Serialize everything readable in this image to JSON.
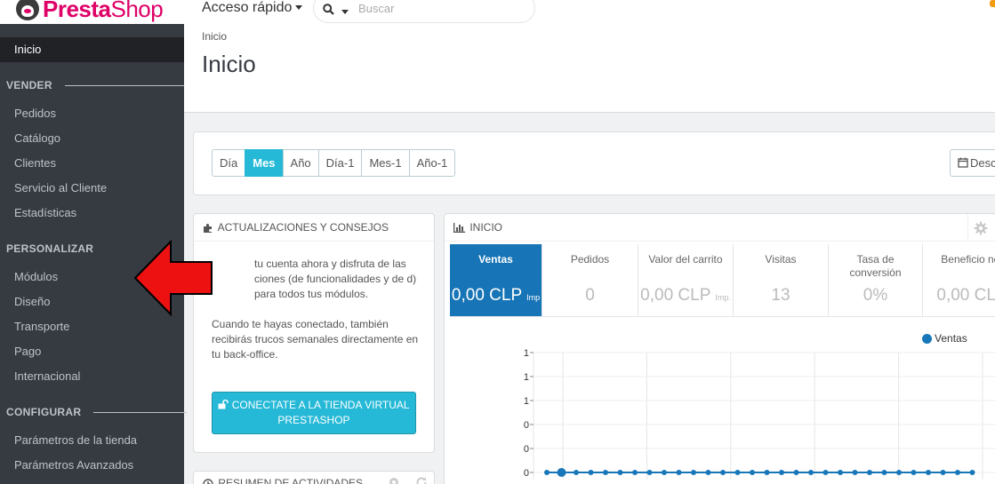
{
  "brand": {
    "name_bold": "Presta",
    "name_light": "Shop"
  },
  "header": {
    "quick_access_label": "Acceso rápido",
    "search_placeholder": "Buscar"
  },
  "sidebar": {
    "active_item": "Inicio",
    "sections": [
      {
        "title": "VENDER",
        "items": [
          "Pedidos",
          "Catálogo",
          "Clientes",
          "Servicio al Cliente",
          "Estadísticas"
        ]
      },
      {
        "title": "PERSONALIZAR",
        "items": [
          "Módulos",
          "Diseño",
          "Transporte",
          "Pago",
          "Internacional"
        ]
      },
      {
        "title": "CONFIGURAR",
        "items": [
          "Parámetros de la tienda",
          "Parámetros Avanzados"
        ]
      }
    ]
  },
  "page": {
    "breadcrumb": "Inicio",
    "title": "Inicio"
  },
  "period": {
    "buttons": [
      "Día",
      "Mes",
      "Año",
      "Día-1",
      "Mes-1",
      "Año-1"
    ],
    "active": "Mes",
    "date_button_label": "Desc"
  },
  "tips_panel": {
    "title": "ACTUALIZACIONES Y CONSEJOS",
    "paragraph_1": "tu cuenta ahora y disfruta de las ciones (de funcionalidades y de d) para todos tus módulos.",
    "paragraph_2": "Cuando te hayas conectado, también recibirás trucos semanales directamente en tu back-office.",
    "button_label_1": "CONECTATE A LA TIENDA VIRTUAL",
    "button_label_2": "PRESTASHOP"
  },
  "dashboard_panel": {
    "title": "INICIO",
    "kpis": [
      {
        "label": "Ventas",
        "value": "0,00 CLP",
        "suffix": "Imp",
        "active": true
      },
      {
        "label": "Pedidos",
        "value": "0",
        "suffix": ""
      },
      {
        "label": "Valor del carrito",
        "value": "0,00 CLP",
        "suffix": "Imp."
      },
      {
        "label": "Visitas",
        "value": "13",
        "suffix": ""
      },
      {
        "label": "Tasa de conversión",
        "value": "0%",
        "suffix": ""
      },
      {
        "label": "Beneficio net",
        "value": "0,00 CLP",
        "suffix": ""
      }
    ],
    "legend": "Ventas"
  },
  "activity_panel": {
    "title": "RESUMEN DE ACTIVIDADES"
  },
  "chart_data": {
    "type": "line",
    "series": [
      {
        "name": "Ventas",
        "values": [
          0,
          0,
          0,
          0,
          0,
          0,
          0,
          0,
          0,
          0,
          0,
          0,
          0,
          0,
          0,
          0,
          0,
          0,
          0,
          0,
          0,
          0,
          0,
          0,
          0,
          0,
          0,
          0,
          0,
          0
        ]
      }
    ],
    "y_tick_labels": [
      "1",
      "1",
      "1",
      "0",
      "0",
      "0"
    ],
    "grid": true
  },
  "colors": {
    "accent": "#25b9d7",
    "sidebar": "#363a41",
    "kpi_active": "#1774b6",
    "series": "#1777b8",
    "brand": "#df0067",
    "arrow": "#ee1111"
  }
}
